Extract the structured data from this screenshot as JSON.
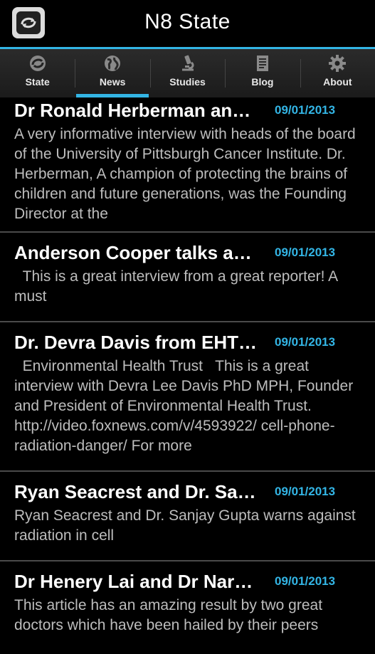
{
  "app": {
    "title": "N8 State"
  },
  "colors": {
    "accent": "#33b5e5",
    "background": "#000000"
  },
  "tabs": [
    {
      "label": "State",
      "icon": "state-icon"
    },
    {
      "label": "News",
      "icon": "globe-icon",
      "selected": true
    },
    {
      "label": "Studies",
      "icon": "microscope-icon"
    },
    {
      "label": "Blog",
      "icon": "document-icon"
    },
    {
      "label": "About",
      "icon": "gear-icon"
    }
  ],
  "news": [
    {
      "title": "Dr Ronald Herberman an…",
      "date": "09/01/2013",
      "description": "A very informative interview with heads of the board of the University of Pittsburgh Cancer Institute. Dr. Herberman, A champion of protecting the brains of children and future generations, was the Founding Director at the"
    },
    {
      "title": "Anderson Cooper talks a…",
      "date": "09/01/2013",
      "description": "  This is a great interview from a great reporter! A must"
    },
    {
      "title": "Dr. Devra Davis from EHT…",
      "date": "09/01/2013",
      "description": "  Environmental Health Trust   This is a great interview with Devra Lee Davis PhD MPH, Founder and President of Environmental Health Trust. http://video.foxnews.com/v/4593922/ cell-phone-radiation-danger/ For more"
    },
    {
      "title": "Ryan Seacrest and Dr. Sa…",
      "date": "09/01/2013",
      "description": "Ryan Seacrest and Dr. Sanjay Gupta warns against radiation in cell"
    },
    {
      "title": "Dr Henery Lai and Dr Nar…",
      "date": "09/01/2013",
      "description": "This article has an amazing result by two great doctors which have been hailed by their peers"
    }
  ]
}
